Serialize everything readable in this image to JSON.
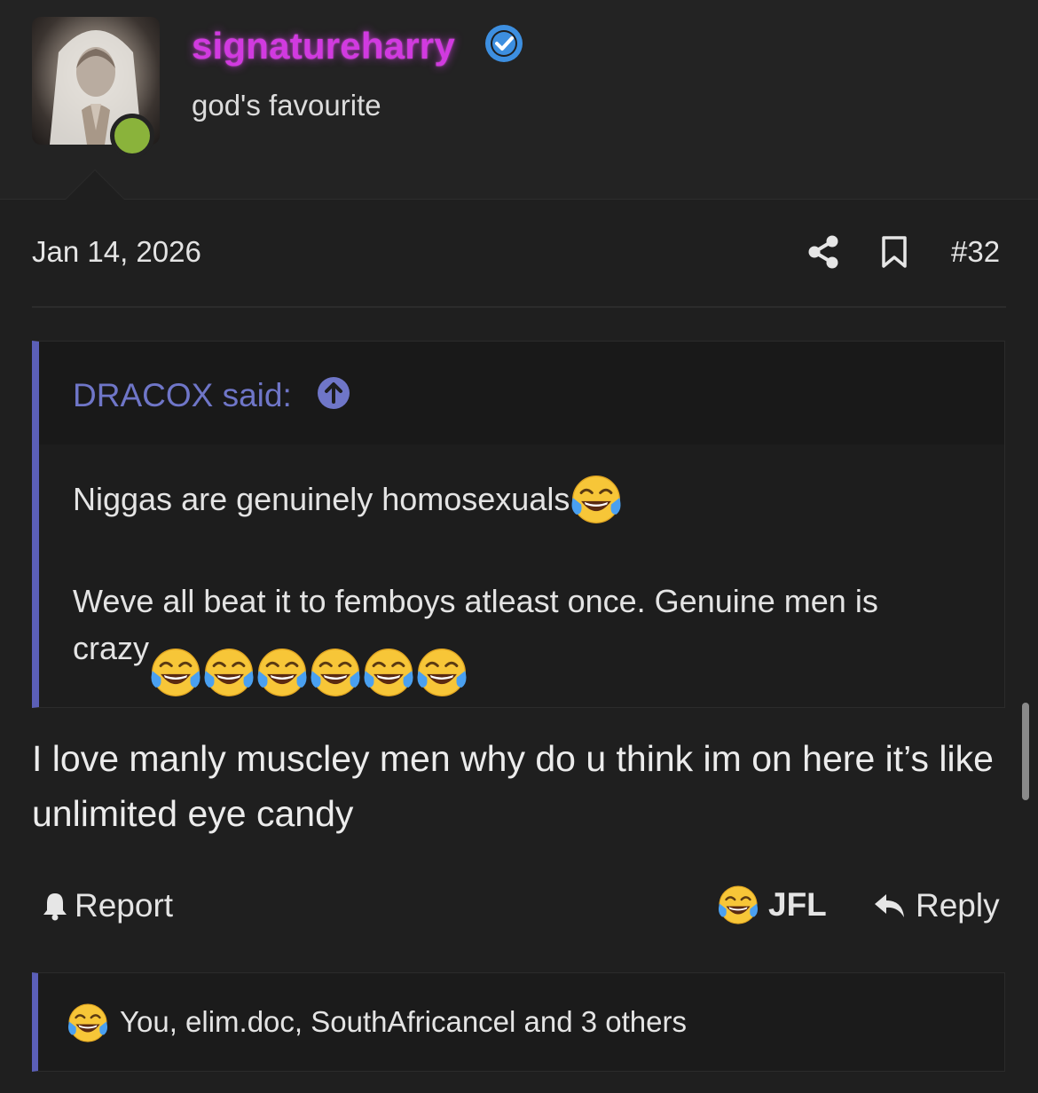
{
  "user": {
    "username": "signatureharry",
    "title": "god's favourite",
    "colors": {
      "username": "#d13ae0",
      "verified": "#3d8fe0",
      "online": "#8ab33b"
    }
  },
  "post": {
    "date": "Jan 14, 2026",
    "number": "#32",
    "quote": {
      "author": "DRACOX said:",
      "line1": "Niggas are genuinely homosexuals",
      "line2": "Weve all beat it to femboys atleast once. Genuine men is",
      "line3": "crazy",
      "accent": "#5b5fb8"
    },
    "message": "I love manly muscley men why do u think im on here it’s like unlimited eye candy"
  },
  "actions": {
    "report_label": "Report",
    "reaction_label": "JFL",
    "reply_label": "Reply"
  },
  "reactions_summary": "You, elim.doc, SouthAfricancel and 3 others",
  "icons": [
    "verified-icon",
    "share-icon",
    "bookmark-icon",
    "arrow-up-icon",
    "bell-icon",
    "reply-icon",
    "crying-laughing-emoji"
  ]
}
